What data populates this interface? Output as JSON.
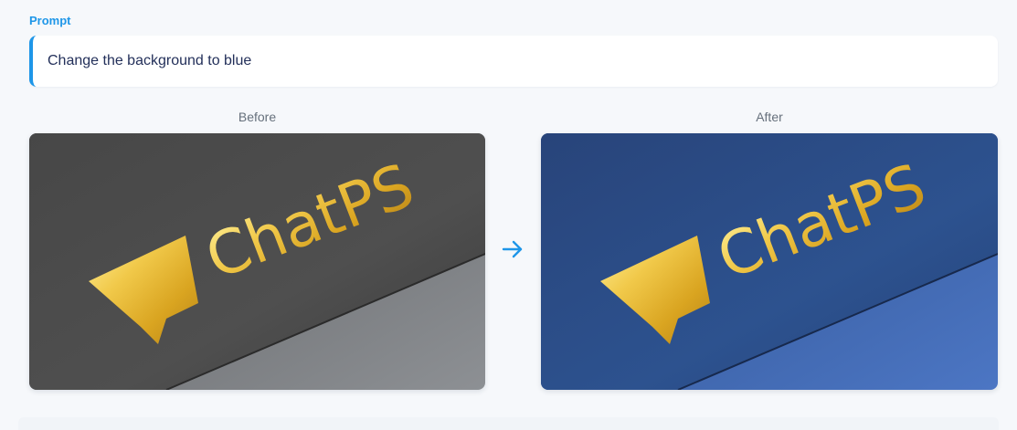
{
  "prompt": {
    "heading": "Prompt",
    "text": "Change the background to blue"
  },
  "comparison": {
    "before_label": "Before",
    "after_label": "After",
    "logo_text": "ChatPS",
    "arrow_icon": "arrow-right-icon",
    "colors": {
      "accent": "#1e96e8",
      "before_card": "#4c4c4c",
      "after_card": "#2b4f8e",
      "logo_gold": "#e7b62a"
    }
  }
}
